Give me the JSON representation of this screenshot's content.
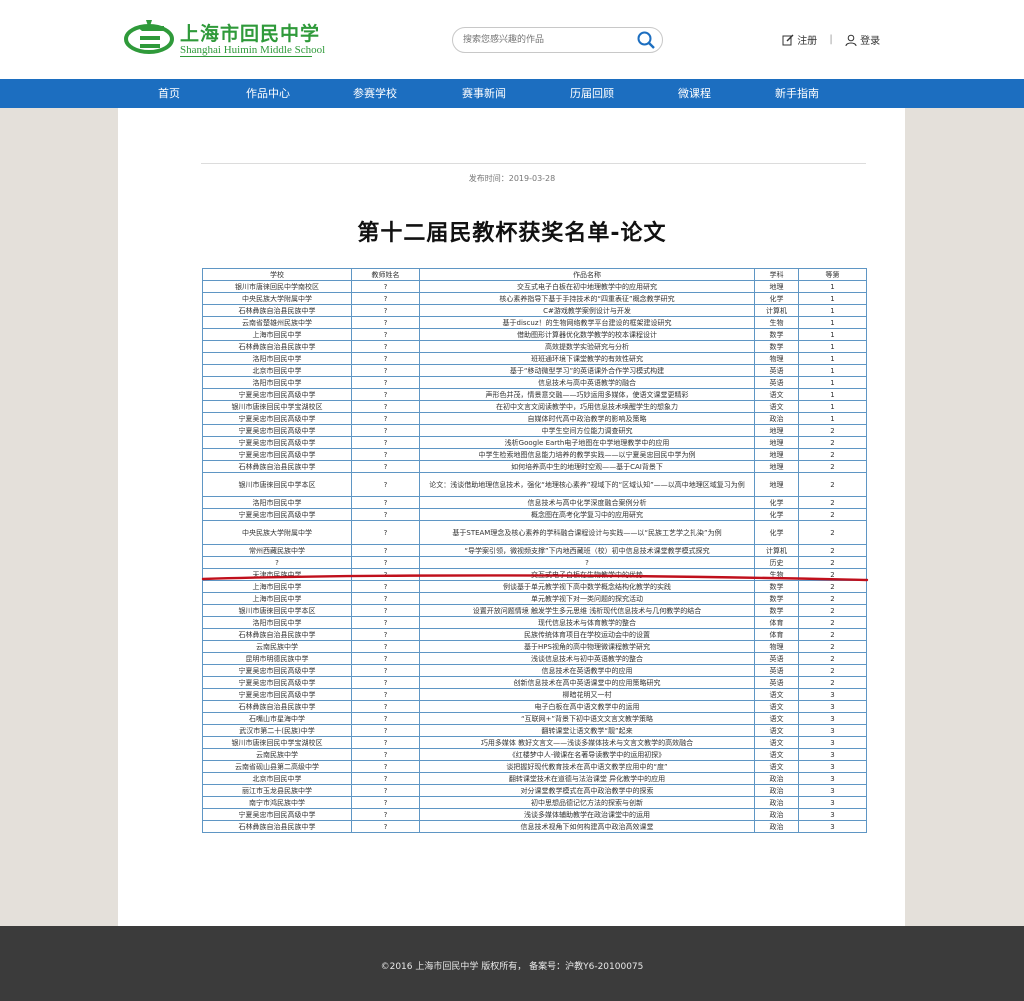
{
  "header": {
    "logo_cn": "上海市回民中学",
    "logo_en": "Shanghai Huimin Middle School",
    "search_placeholder": "搜索您感兴趣的作品",
    "register_label": "注册",
    "separator": "|",
    "login_label": "登录"
  },
  "nav": {
    "items": [
      {
        "label": "首页"
      },
      {
        "label": "作品中心"
      },
      {
        "label": "参赛学校"
      },
      {
        "label": "赛事新闻"
      },
      {
        "label": "历届回顾"
      },
      {
        "label": "微课程"
      },
      {
        "label": "新手指南"
      }
    ]
  },
  "article": {
    "publish_time": "发布时间：2019-03-28",
    "title": "第十二届民教杯获奖名单-论文"
  },
  "table": {
    "headers": [
      "学校",
      "教师姓名",
      "作品名称",
      "学科",
      "等第"
    ],
    "rows": [
      [
        "银川市唐徕回民中学南校区",
        "?",
        "交互式电子白板在初中地理教学中的应用研究",
        "地理",
        "1"
      ],
      [
        "中央民族大学附属中学",
        "?",
        "核心素养指导下基于手持技术的“四重表征”概念教学研究",
        "化学",
        "1"
      ],
      [
        "石林彝族自治县民族中学",
        "?",
        "C#游戏教学案例设计与开发",
        "计算机",
        "1"
      ],
      [
        "云南省楚雄州民族中学",
        "?",
        "基于discuz！的生物网络教学平台建设的框架建设研究",
        "生物",
        "1"
      ],
      [
        "上海市回民中学",
        "?",
        "借助图形计算器优化数学教学的校本课程设计",
        "数学",
        "1"
      ],
      [
        "石林彝族自治县民族中学",
        "?",
        "高效提数学实验研究与分析",
        "数学",
        "1"
      ],
      [
        "洛阳市回民中学",
        "?",
        "班班通环境下课堂教学的有效性研究",
        "物理",
        "1"
      ],
      [
        "北京市回民中学",
        "?",
        "基于“移动微型学习”的英语课外合作学习模式构建",
        "英语",
        "1"
      ],
      [
        "洛阳市回民中学",
        "?",
        "信息技术与高中英语教学的融合",
        "英语",
        "1"
      ],
      [
        "宁夏吴忠市回民高级中学",
        "?",
        "声形色并茂，情景意交融——巧妙运用多媒体，使语文课堂更精彩",
        "语文",
        "1"
      ],
      [
        "银川市唐徕回民中学宝湖校区",
        "?",
        "在初中文言文阅读教学中，巧用信息技术唤醒学生的想象力",
        "语文",
        "1"
      ],
      [
        "宁夏吴忠市回民高级中学",
        "?",
        "自媒体时代高中政治教学的影响及策略",
        "政治",
        "1"
      ],
      [
        "宁夏吴忠市回民高级中学",
        "?",
        "中学生空间方位能力调查研究",
        "地理",
        "2"
      ],
      [
        "宁夏吴忠市回民高级中学",
        "?",
        "浅析Google Earth电子地图在中学地理教学中的应用",
        "地理",
        "2"
      ],
      [
        "宁夏吴忠市回民高级中学",
        "?",
        "中学生检索地图信息能力培养的教学实践——以宁夏吴忠回民中学为例",
        "地理",
        "2"
      ],
      [
        "石林彝族自治县民族中学",
        "?",
        "如何培养高中生的地理时空观——基于CAI背景下",
        "地理",
        "2"
      ],
      [
        "银川市唐徕回民中学本区",
        "?",
        "论文：浅谈借助地理信息技术，强化“地理核心素养”视域下的“区域认知”——以高中地理区域复习为例",
        "地理",
        "2"
      ],
      [
        "洛阳市回民中学",
        "?",
        "信息技术与高中化学深度融合案例分析",
        "化学",
        "2"
      ],
      [
        "宁夏吴忠市回民高级中学",
        "?",
        "概念图在高考化学复习中的应用研究",
        "化学",
        "2"
      ],
      [
        "中央民族大学附属中学",
        "?",
        "基于STEAM理念及核心素养的学科融合课程设计与实践——以“民族工艺学之扎染”为例",
        "化学",
        "2"
      ],
      [
        "常州西藏民族中学",
        "?",
        "“导学案引领，微视频支撑”下内地西藏班（校）初中信息技术课堂教学模式探究",
        "计算机",
        "2"
      ],
      [
        "?",
        "?",
        "?",
        "历史",
        "2"
      ],
      [
        "天津市民族中学",
        "?",
        "交互式电子白板在生物教学中的优势",
        "生物",
        "2"
      ],
      [
        "上海市回民中学",
        "?",
        "例谈基于单元教学视下高中数学概念结构化教学的实践",
        "数学",
        "2"
      ],
      [
        "上海市回民中学",
        "?",
        "单元教学视下对一类问题的探究活动",
        "数学",
        "2"
      ],
      [
        "银川市唐徕回民中学本区",
        "?",
        "设置开放问题情境 触发学生多元思维 浅析现代信息技术与几何教学的结合",
        "数学",
        "2"
      ],
      [
        "洛阳市回民中学",
        "?",
        "现代信息技术与体育教学的整合",
        "体育",
        "2"
      ],
      [
        "石林彝族自治县民族中学",
        "?",
        "民族传统体育项目在学校运动会中的设置",
        "体育",
        "2"
      ],
      [
        "云南民族中学",
        "?",
        "基于HPS视角的高中物理微课程教学研究",
        "物理",
        "2"
      ],
      [
        "昆明市明德民族中学",
        "?",
        "浅谈信息技术与初中英语教学的整合",
        "英语",
        "2"
      ],
      [
        "宁夏吴忠市回民高级中学",
        "?",
        "信息技术在英语教学中的应用",
        "英语",
        "2"
      ],
      [
        "宁夏吴忠市回民高级中学",
        "?",
        "创新信息技术在高中英语课堂中的应用策略研究",
        "英语",
        "2"
      ],
      [
        "宁夏吴忠市回民高级中学",
        "?",
        "柳暗花明又一村",
        "语文",
        "3"
      ],
      [
        "石林彝族自治县民族中学",
        "?",
        "电子白板在高中语文教学中的运用",
        "语文",
        "3"
      ],
      [
        "石嘴山市星海中学",
        "?",
        "“互联网+”背景下初中语文文言文教学策略",
        "语文",
        "3"
      ],
      [
        "武汉市第二十(民族)中学",
        "?",
        "翻转课堂让语文教学“靓”起来",
        "语文",
        "3"
      ],
      [
        "银川市唐徕回民中学宝湖校区",
        "?",
        "巧用多媒体 教好文言文——浅谈多媒体技术与文言文教学的高效融合",
        "语文",
        "3"
      ],
      [
        "云南民族中学",
        "?",
        "《红楼梦中人-微课在名著导读教学中的运用初探》",
        "语文",
        "3"
      ],
      [
        "云南省砚山县第二高级中学",
        "?",
        "谈把握好现代教育技术在高中语文教学应用中的“度”",
        "语文",
        "3"
      ],
      [
        "北京市回民中学",
        "?",
        "翻转课堂技术在道德与法治课堂 异化教学中的应用",
        "政治",
        "3"
      ],
      [
        "丽江市玉龙县民族中学",
        "?",
        "对分课堂教学模式在高中政治教学中的探索",
        "政治",
        "3"
      ],
      [
        "南宁市鸿民族中学",
        "?",
        "初中思想品德记忆方法的探索与创新",
        "政治",
        "3"
      ],
      [
        "宁夏吴忠市回民高级中学",
        "?",
        "浅谈多媒体辅助教学在政治课堂中的运用",
        "政治",
        "3"
      ],
      [
        "石林彝族自治县民族中学",
        "?",
        "信息技术视角下如何构建高中政治高效课堂",
        "政治",
        "3"
      ]
    ]
  },
  "footer": {
    "text": "©2016 上海市回民中学 版权所有， 备案号：沪教Y6-20100075"
  },
  "colors": {
    "brand_green": "#2f9a3a",
    "nav_blue": "#1c6ec0",
    "table_border": "#5f96c4",
    "annotation_red": "#c0101c",
    "footer_bg": "#3b3b3b"
  }
}
